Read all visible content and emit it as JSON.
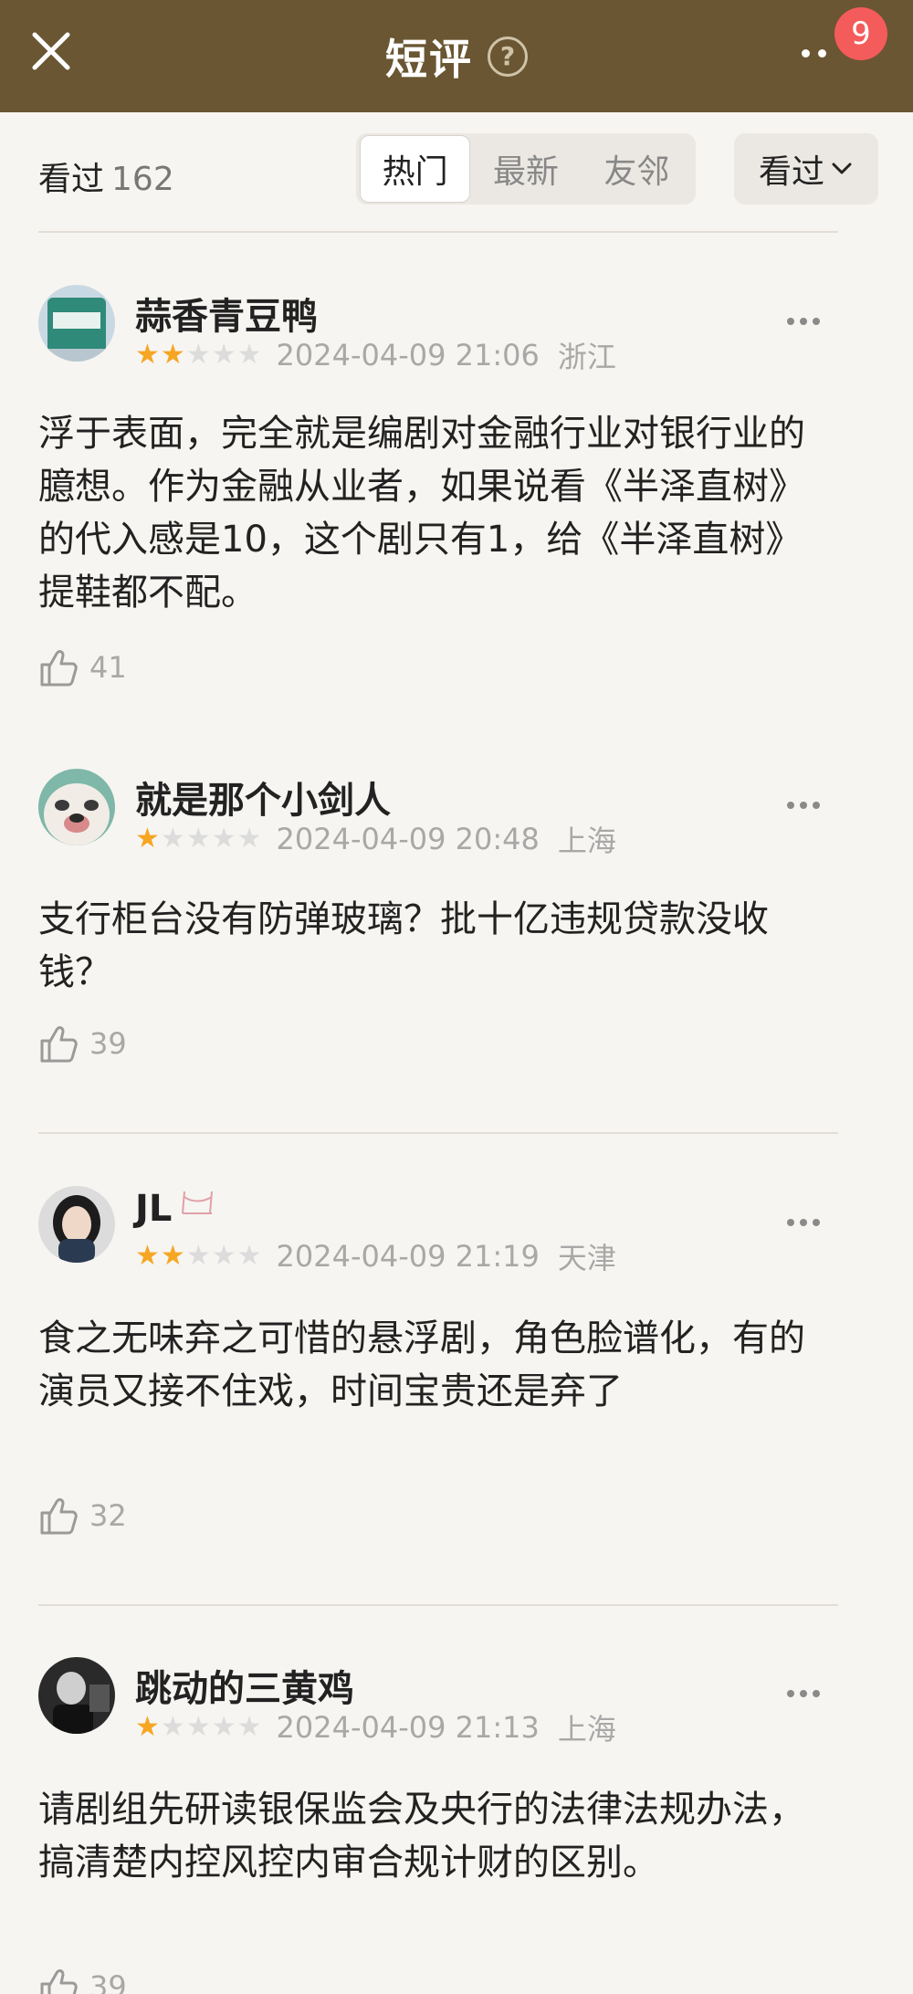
{
  "header": {
    "title": "短评",
    "help_symbol": "?",
    "badge_count": "9",
    "close_icon": "close-icon",
    "more_icon": "more-dots-icon"
  },
  "filter": {
    "seen_label": "看过",
    "seen_count": "162",
    "tabs": [
      {
        "label": "热门",
        "active": true
      },
      {
        "label": "最新",
        "active": false
      },
      {
        "label": "友邻",
        "active": false
      }
    ],
    "dropdown_label": "看过",
    "dropdown_icon": "chevron-down-icon"
  },
  "reviews": [
    {
      "username": "蒜香青豆鸭",
      "stars": 2,
      "datetime": "2024-04-09 21:06",
      "location": "浙江",
      "text": "浮于表面，完全就是编剧对金融行业对银行业的臆想。作为金融从业者，如果说看《半泽直树》的代入感是10，这个剧只有1，给《半泽直树》提鞋都不配。",
      "likes": "41"
    },
    {
      "username": "就是那个小剑人",
      "stars": 1,
      "datetime": "2024-04-09 20:48",
      "location": "上海",
      "text": "支行柜台没有防弹玻璃？批十亿违规贷款没收钱？",
      "likes": "39"
    },
    {
      "username": "JL",
      "stars": 2,
      "datetime": "2024-04-09 21:19",
      "location": "天津",
      "text": "食之无味弃之可惜的悬浮剧，角色脸谱化，有的演员又接不住戏，时间宝贵还是弃了",
      "likes": "32"
    },
    {
      "username": "跳动的三黄鸡",
      "stars": 1,
      "datetime": "2024-04-09 21:13",
      "location": "上海",
      "text": "请剧组先研读银保监会及央行的法律法规办法，搞清楚内控风控内审合规计财的区别。",
      "likes": "39"
    }
  ],
  "colors": {
    "header_bg": "#6a5632",
    "badge": "#f45b5b",
    "star_on": "#f6a623",
    "star_off": "#dcdcdc",
    "page_bg": "#f7f5f1"
  }
}
